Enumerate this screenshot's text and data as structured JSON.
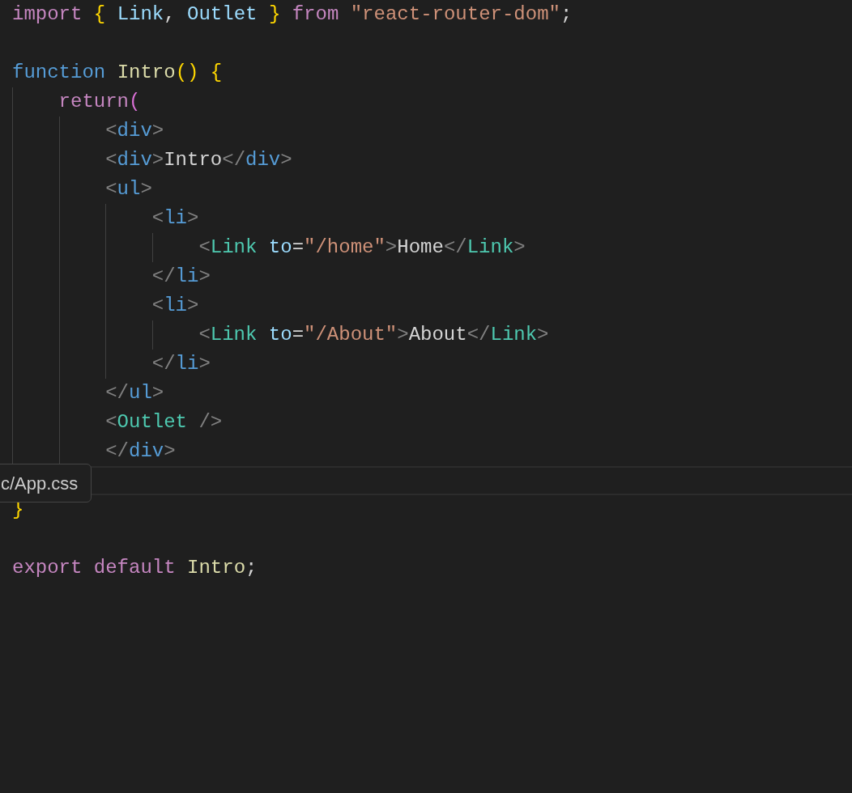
{
  "editor": {
    "lines": [
      {
        "current": false,
        "tokens": [
          {
            "kind": "keyword",
            "text": "import "
          },
          {
            "kind": "brace",
            "text": "{ "
          },
          {
            "kind": "variable",
            "text": "Link"
          },
          {
            "kind": "plain",
            "text": ", "
          },
          {
            "kind": "variable",
            "text": "Outlet "
          },
          {
            "kind": "brace",
            "text": "} "
          },
          {
            "kind": "keyword",
            "text": "from "
          },
          {
            "kind": "string",
            "text": "\"react-router-dom\""
          },
          {
            "kind": "plain",
            "text": ";"
          }
        ]
      },
      {
        "current": false
      },
      {
        "current": false,
        "tokens": [
          {
            "kind": "storage",
            "text": "function "
          },
          {
            "kind": "function",
            "text": "Intro"
          },
          {
            "kind": "brace",
            "text": "() {"
          }
        ],
        "children": [
          {
            "current": false,
            "tokens": [
              {
                "kind": "keyword",
                "text": "return"
              },
              {
                "kind": "paren",
                "text": "("
              }
            ],
            "children": [
              {
                "current": false,
                "tokens": [
                  {
                    "kind": "punct",
                    "text": "<"
                  },
                  {
                    "kind": "tag",
                    "text": "div"
                  },
                  {
                    "kind": "punct",
                    "text": ">"
                  }
                ]
              },
              {
                "current": false,
                "tokens": [
                  {
                    "kind": "punct",
                    "text": "<"
                  },
                  {
                    "kind": "tag",
                    "text": "div"
                  },
                  {
                    "kind": "punct",
                    "text": ">"
                  },
                  {
                    "kind": "plain",
                    "text": "Intro"
                  },
                  {
                    "kind": "punct",
                    "text": "</"
                  },
                  {
                    "kind": "tag",
                    "text": "div"
                  },
                  {
                    "kind": "punct",
                    "text": ">"
                  }
                ]
              },
              {
                "current": false,
                "tokens": [
                  {
                    "kind": "punct",
                    "text": "<"
                  },
                  {
                    "kind": "tag",
                    "text": "ul"
                  },
                  {
                    "kind": "punct",
                    "text": ">"
                  }
                ],
                "children": [
                  {
                    "current": false,
                    "tokens": [
                      {
                        "kind": "punct",
                        "text": "<"
                      },
                      {
                        "kind": "tag",
                        "text": "li"
                      },
                      {
                        "kind": "punct",
                        "text": ">"
                      }
                    ],
                    "children": [
                      {
                        "current": false,
                        "tokens": [
                          {
                            "kind": "punct",
                            "text": "<"
                          },
                          {
                            "kind": "component",
                            "text": "Link "
                          },
                          {
                            "kind": "variable",
                            "text": "to"
                          },
                          {
                            "kind": "plain",
                            "text": "="
                          },
                          {
                            "kind": "string",
                            "text": "\"/home\""
                          },
                          {
                            "kind": "punct",
                            "text": ">"
                          },
                          {
                            "kind": "plain",
                            "text": "Home"
                          },
                          {
                            "kind": "punct",
                            "text": "</"
                          },
                          {
                            "kind": "component",
                            "text": "Link"
                          },
                          {
                            "kind": "punct",
                            "text": ">"
                          }
                        ]
                      }
                    ]
                  },
                  {
                    "current": false,
                    "tokens": [
                      {
                        "kind": "punct",
                        "text": "</"
                      },
                      {
                        "kind": "tag",
                        "text": "li"
                      },
                      {
                        "kind": "punct",
                        "text": ">"
                      }
                    ]
                  },
                  {
                    "current": false,
                    "tokens": [
                      {
                        "kind": "punct",
                        "text": "<"
                      },
                      {
                        "kind": "tag",
                        "text": "li"
                      },
                      {
                        "kind": "punct",
                        "text": ">"
                      }
                    ],
                    "children": [
                      {
                        "current": false,
                        "tokens": [
                          {
                            "kind": "punct",
                            "text": "<"
                          },
                          {
                            "kind": "component",
                            "text": "Link "
                          },
                          {
                            "kind": "variable",
                            "text": "to"
                          },
                          {
                            "kind": "plain",
                            "text": "="
                          },
                          {
                            "kind": "string",
                            "text": "\"/About\""
                          },
                          {
                            "kind": "punct",
                            "text": ">"
                          },
                          {
                            "kind": "plain",
                            "text": "About"
                          },
                          {
                            "kind": "punct",
                            "text": "</"
                          },
                          {
                            "kind": "component",
                            "text": "Link"
                          },
                          {
                            "kind": "punct",
                            "text": ">"
                          }
                        ]
                      }
                    ]
                  },
                  {
                    "current": false,
                    "tokens": [
                      {
                        "kind": "punct",
                        "text": "</"
                      },
                      {
                        "kind": "tag",
                        "text": "li"
                      },
                      {
                        "kind": "punct",
                        "text": ">"
                      }
                    ]
                  }
                ]
              },
              {
                "current": false,
                "tokens": [
                  {
                    "kind": "punct",
                    "text": "</"
                  },
                  {
                    "kind": "tag",
                    "text": "ul"
                  },
                  {
                    "kind": "punct",
                    "text": ">"
                  }
                ]
              },
              {
                "current": false,
                "tokens": [
                  {
                    "kind": "punct",
                    "text": "<"
                  },
                  {
                    "kind": "component",
                    "text": "Outlet "
                  },
                  {
                    "kind": "punct",
                    "text": "/>"
                  }
                ]
              },
              {
                "current": false,
                "tokens": [
                  {
                    "kind": "punct",
                    "text": "</"
                  },
                  {
                    "kind": "tag",
                    "text": "div"
                  },
                  {
                    "kind": "punct",
                    "text": ">"
                  }
                ]
              }
            ]
          }
        ]
      },
      {
        "current": true
      },
      {
        "current": false,
        "tokens": [
          {
            "kind": "brace",
            "text": "}"
          }
        ]
      },
      {
        "current": false
      },
      {
        "current": false,
        "tokens": [
          {
            "kind": "keyword",
            "text": "export default "
          },
          {
            "kind": "function",
            "text": "Intro"
          },
          {
            "kind": "plain",
            "text": ";"
          }
        ]
      }
    ]
  },
  "tooltip": {
    "text": "c/App.css"
  }
}
